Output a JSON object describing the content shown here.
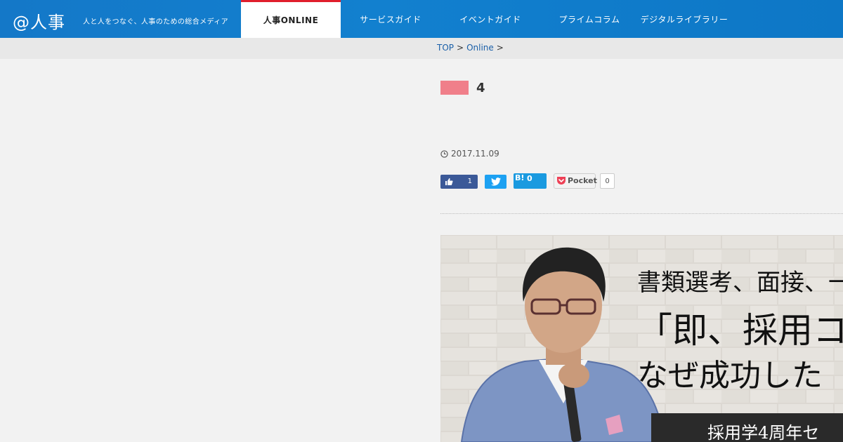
{
  "header": {
    "logo": "@人事",
    "tagline": "人と人をつなぐ、人事のための総合メディア",
    "nav": [
      {
        "label": "人事ONLINE",
        "active": true
      },
      {
        "label": "サービスガイド"
      },
      {
        "label": "イベントガイド"
      },
      {
        "label": "プライムコラム"
      },
      {
        "label": "デジタルライブラリー"
      }
    ],
    "accent_color": "#1478c8",
    "active_border_color": "#e01e2c"
  },
  "breadcrumb": {
    "items": [
      "TOP",
      "Online"
    ],
    "separator": ">"
  },
  "article": {
    "category_color": "#f07f8a",
    "title": "4",
    "date": "2017.11.09",
    "share": {
      "facebook_count": "1",
      "hatena_label": "B!",
      "hatena_count": "0",
      "pocket_label": "Pocket",
      "pocket_count": "0"
    },
    "hero": {
      "line1": "書類選考、面接、一",
      "line2": "「即、採用コー",
      "line3": "なぜ成功した",
      "band": "採用学4周年セ"
    }
  }
}
